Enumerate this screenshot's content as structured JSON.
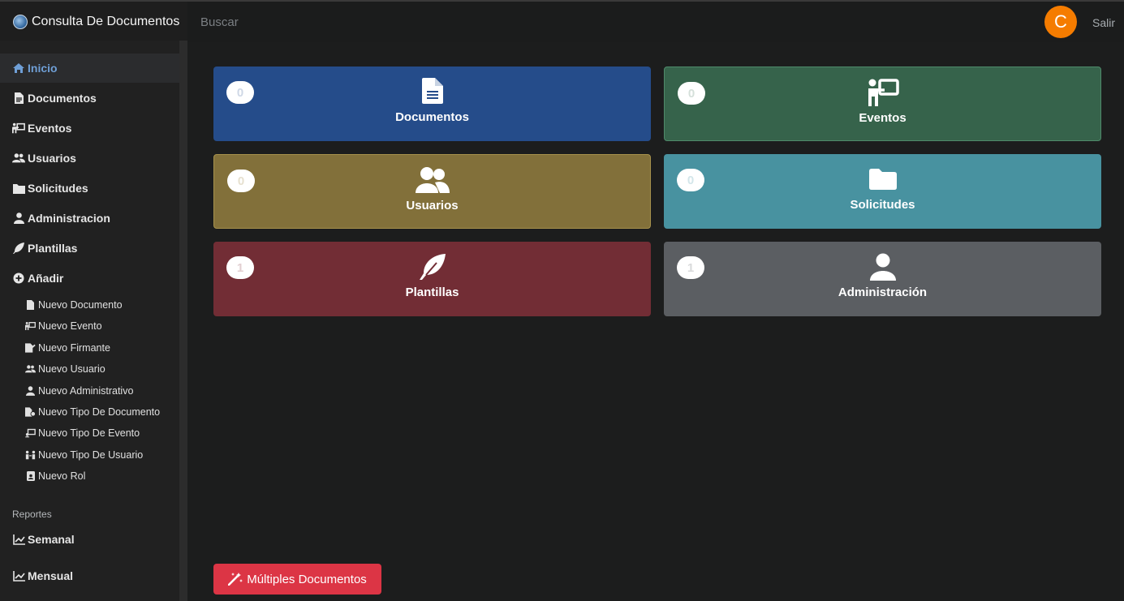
{
  "app": {
    "title": "Consulta De Documentos"
  },
  "header": {
    "search_placeholder": "Buscar",
    "avatar_initial": "C",
    "logout_label": "Salir",
    "avatar_color": "#f57c00"
  },
  "sidebar": {
    "items": [
      {
        "label": "Inicio",
        "icon": "home-icon",
        "active": true
      },
      {
        "label": "Documentos",
        "icon": "file-icon"
      },
      {
        "label": "Eventos",
        "icon": "presentation-icon"
      },
      {
        "label": "Usuarios",
        "icon": "users-icon"
      },
      {
        "label": "Solicitudes",
        "icon": "folder-icon"
      },
      {
        "label": "Administracion",
        "icon": "user-icon"
      },
      {
        "label": "Plantillas",
        "icon": "feather-icon"
      },
      {
        "label": "Añadir",
        "icon": "plus-circle-icon"
      }
    ],
    "add_items": [
      {
        "label": "Nuevo Documento",
        "icon": "file-icon"
      },
      {
        "label": "Nuevo Evento",
        "icon": "presentation-icon"
      },
      {
        "label": "Nuevo Firmante",
        "icon": "signature-icon"
      },
      {
        "label": "Nuevo Usuario",
        "icon": "users-icon"
      },
      {
        "label": "Nuevo Administrativo",
        "icon": "user-icon"
      },
      {
        "label": "Nuevo Tipo De Documento",
        "icon": "file-gear-icon"
      },
      {
        "label": "Nuevo Tipo De Evento",
        "icon": "board-icon"
      },
      {
        "label": "Nuevo Tipo De Usuario",
        "icon": "people-arrows-icon"
      },
      {
        "label": "Nuevo Rol",
        "icon": "id-badge-icon"
      }
    ],
    "reports_label": "Reportes",
    "reports": [
      {
        "label": "Semanal",
        "icon": "chart-line-icon"
      },
      {
        "label": "Mensual",
        "icon": "chart-line-icon"
      }
    ]
  },
  "cards": [
    {
      "label": "Documentos",
      "count": "0",
      "color": "#254c8a",
      "badge_text_color": "#cfd8e6",
      "icon": "file-icon"
    },
    {
      "label": "Eventos",
      "count": "0",
      "color": "#36634b",
      "badge_text_color": "#d5e0da",
      "icon": "presentation-icon"
    },
    {
      "label": "Usuarios",
      "count": "0",
      "color": "#82703a",
      "badge_text_color": "#e6e0cf",
      "icon": "users-icon"
    },
    {
      "label": "Solicitudes",
      "count": "0",
      "color": "#4892a0",
      "badge_text_color": "#d3e6ea",
      "icon": "folder-icon"
    },
    {
      "label": "Plantillas",
      "count": "1",
      "color": "#722d35",
      "badge_text_color": "#e2cfd1",
      "icon": "feather-icon"
    },
    {
      "label": "Administración",
      "count": "1",
      "color": "#5b5e62",
      "badge_text_color": "#d9dadb",
      "icon": "user-icon"
    }
  ],
  "actions": {
    "multi_label": "Múltiples Documentos",
    "multi_color": "#dc3545"
  }
}
